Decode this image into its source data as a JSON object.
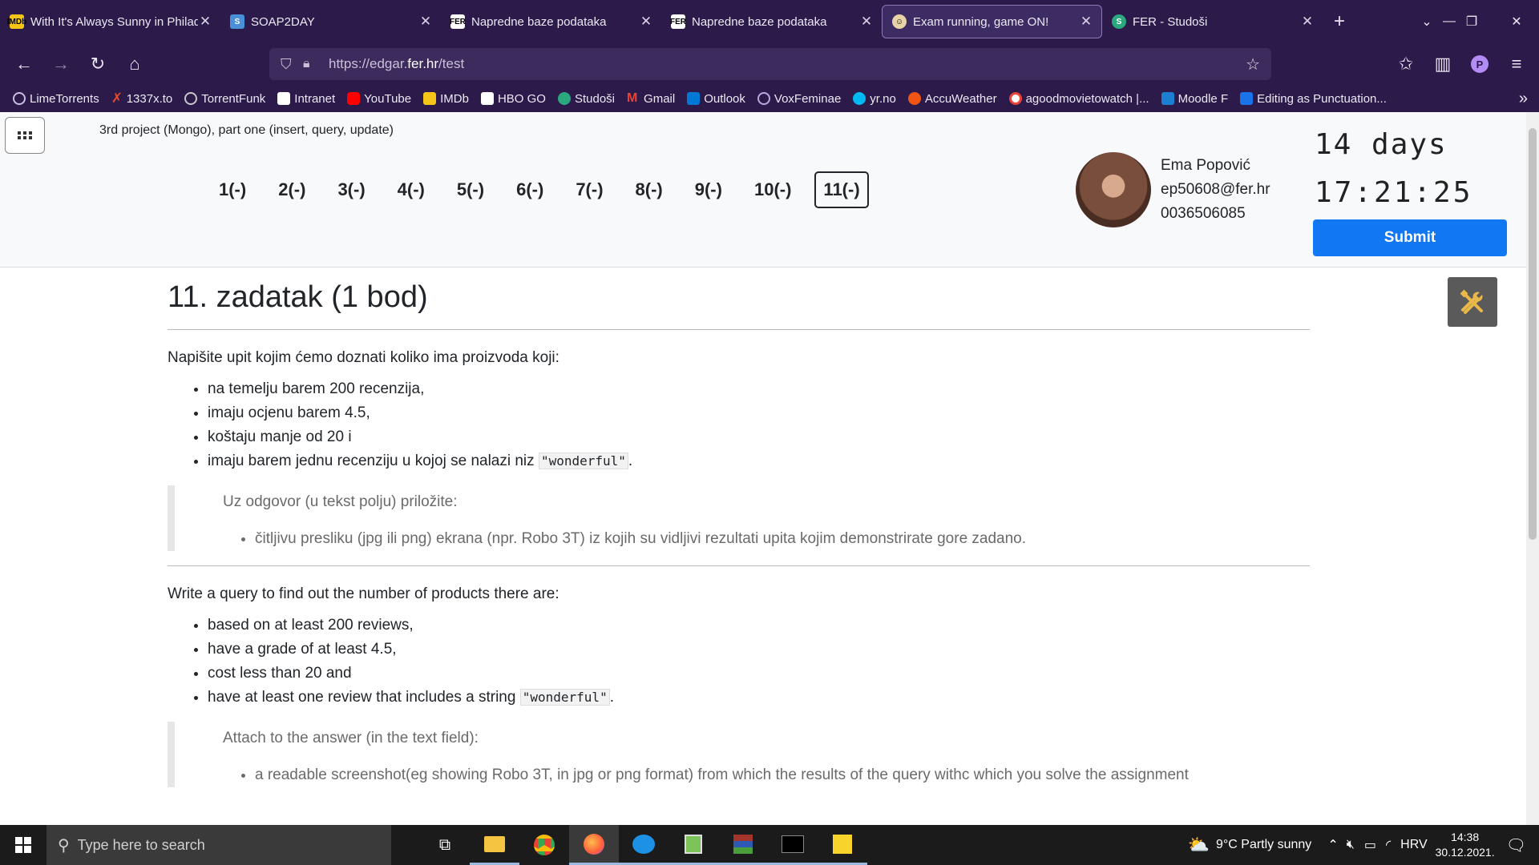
{
  "browser": {
    "tabs": [
      {
        "title": "With It's Always Sunny in Philade",
        "icon": "imdb-icon",
        "color": "#f5c518"
      },
      {
        "title": "SOAP2DAY",
        "icon": "soap2day-icon",
        "color": "#4a90d9"
      },
      {
        "title": "Napredne baze podataka",
        "icon": "fer-icon",
        "color": "#ffffff"
      },
      {
        "title": "Napredne baze podataka",
        "icon": "fer-icon",
        "color": "#ffffff"
      },
      {
        "title": "Exam running, game ON!",
        "icon": "edgar-icon",
        "color": "#e8d2a8"
      },
      {
        "title": "FER - Studoši",
        "icon": "studosi-icon",
        "color": "#2aa87e"
      }
    ],
    "url_prefix": "https://edgar.",
    "url_domain": "fer.hr",
    "url_path": "/test",
    "bookmarks": [
      {
        "label": "LimeTorrents",
        "color": "#7b68c9"
      },
      {
        "label": "1337x.to",
        "color": "#e24a2c"
      },
      {
        "label": "TorrentFunk",
        "color": "#c7c7c7"
      },
      {
        "label": "Intranet",
        "color": "#ffffff"
      },
      {
        "label": "YouTube",
        "color": "#ff0000"
      },
      {
        "label": "IMDb",
        "color": "#f5c518"
      },
      {
        "label": "HBO GO",
        "color": "#ffffff"
      },
      {
        "label": "Studoši",
        "color": "#2aa87e"
      },
      {
        "label": "Gmail",
        "color": "#ea4335"
      },
      {
        "label": "Outlook",
        "color": "#0078d4"
      },
      {
        "label": "VoxFeminae",
        "color": "#b8a8e0"
      },
      {
        "label": "yr.no",
        "color": "#00b8f1"
      },
      {
        "label": "AccuWeather",
        "color": "#f05514"
      },
      {
        "label": "agoodmovietowatch |...",
        "color": "#e8443a"
      },
      {
        "label": "Moodle F",
        "color": "#1d7fd1"
      },
      {
        "label": "Editing as Punctuation...",
        "color": "#1a73e8"
      }
    ]
  },
  "exam": {
    "project_title": "3rd project (Mongo), part one (insert, query, update)",
    "questions": [
      "1(-)",
      "2(-)",
      "3(-)",
      "4(-)",
      "5(-)",
      "6(-)",
      "7(-)",
      "8(-)",
      "9(-)",
      "10(-)",
      "11(-)"
    ],
    "active_question_index": 10,
    "user": {
      "name": "Ema Popović",
      "email": "ep50608@fer.hr",
      "id": "0036506085"
    },
    "timer_days": "14 days",
    "timer_clock": "17:21:25",
    "submit_label": "Submit"
  },
  "question": {
    "title": "11. zadatak (1 bod)",
    "hr_intro": "Napišite upit kojim ćemo doznati koliko ima proizvoda koji:",
    "hr_items": [
      "na temelju barem 200 recenzija,",
      "imaju ocjenu barem 4.5,",
      "koštaju manje od 20 i",
      "imaju barem jednu recenziju u kojoj se nalazi niz "
    ],
    "hr_code": "\"wonderful\"",
    "hr_after_code": ".",
    "hr_attach": "Uz odgovor (u tekst polju) priložite:",
    "hr_attach_item": "čitljivu presliku (jpg ili png) ekrana (npr. Robo 3T) iz kojih su vidljivi rezultati upita kojim demonstrirate gore zadano.",
    "en_intro": "Write a query to find out the number of products there are:",
    "en_items": [
      "based on at least 200 reviews,",
      "have a grade of at least 4.5,",
      "cost less than 20 and",
      "have at least one review that includes a string "
    ],
    "en_code": "\"wonderful\"",
    "en_after_code": ".",
    "en_attach": "Attach to the answer (in the text field):",
    "en_attach_item": "a readable screenshot(eg showing Robo 3T, in jpg or png format) from which the results of the query withc which you solve the assignment"
  },
  "taskbar": {
    "search_placeholder": "Type here to search",
    "weather": "9°C  Partly sunny",
    "language": "HRV",
    "time": "14:38",
    "date": "30.12.2021."
  }
}
